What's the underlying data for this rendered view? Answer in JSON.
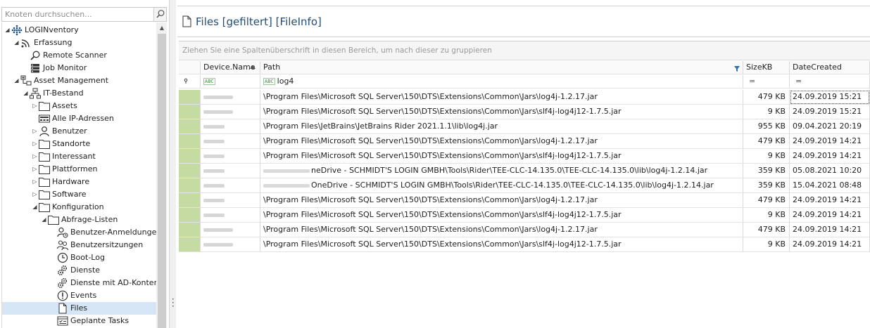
{
  "navigation": {
    "search_placeholder": "Knoten durchsuchen...",
    "tree": [
      {
        "label": "LOGINventory",
        "level": 0,
        "expander": "open",
        "icon": "loginventory-logo-icon"
      },
      {
        "label": "Erfassung",
        "level": 1,
        "expander": "open",
        "icon": "wifi-signal-icon"
      },
      {
        "label": "Remote Scanner",
        "level": 2,
        "expander": "none",
        "icon": "magnifier-icon"
      },
      {
        "label": "Job Monitor",
        "level": 2,
        "expander": "none",
        "icon": "server-icon"
      },
      {
        "label": "Asset Management",
        "level": 1,
        "expander": "open",
        "icon": "asset-network-icon"
      },
      {
        "label": "IT-Bestand",
        "level": 2,
        "expander": "open",
        "icon": "hierarchy-icon"
      },
      {
        "label": "Assets",
        "level": 3,
        "expander": "closed",
        "icon": "folder-icon"
      },
      {
        "label": "Alle IP-Adressen",
        "level": 3,
        "expander": "none",
        "icon": "ip-address-icon"
      },
      {
        "label": "Benutzer",
        "level": 3,
        "expander": "closed",
        "icon": "user-icon"
      },
      {
        "label": "Standorte",
        "level": 3,
        "expander": "closed",
        "icon": "folder-icon"
      },
      {
        "label": "Interessant",
        "level": 3,
        "expander": "closed",
        "icon": "folder-icon"
      },
      {
        "label": "Plattformen",
        "level": 3,
        "expander": "closed",
        "icon": "folder-icon"
      },
      {
        "label": "Hardware",
        "level": 3,
        "expander": "closed",
        "icon": "folder-icon"
      },
      {
        "label": "Software",
        "level": 3,
        "expander": "closed",
        "icon": "folder-icon"
      },
      {
        "label": "Konfiguration",
        "level": 3,
        "expander": "open",
        "icon": "folder-icon"
      },
      {
        "label": "Abfrage-Listen",
        "level": 4,
        "expander": "open",
        "icon": "folder-icon"
      },
      {
        "label": "Benutzer-Anmeldungen",
        "level": 5,
        "expander": "none",
        "icon": "user-login-icon"
      },
      {
        "label": "Benutzersitzungen",
        "level": 5,
        "expander": "none",
        "icon": "users-icon"
      },
      {
        "label": "Boot-Log",
        "level": 5,
        "expander": "none",
        "icon": "clock-icon"
      },
      {
        "label": "Dienste",
        "level": 5,
        "expander": "none",
        "icon": "gears-icon"
      },
      {
        "label": "Dienste mit AD-Konten",
        "level": 5,
        "expander": "none",
        "icon": "gears-icon"
      },
      {
        "label": "Events",
        "level": 5,
        "expander": "none",
        "icon": "exclamation-icon"
      },
      {
        "label": "Files",
        "level": 5,
        "expander": "none",
        "icon": "file-icon",
        "selected": true
      },
      {
        "label": "Geplante Tasks",
        "level": 5,
        "expander": "none",
        "icon": "tasks-icon"
      }
    ]
  },
  "page": {
    "title": "Files [gefiltert] [FileInfo]",
    "group_hint": "Ziehen Sie eine Spaltenüberschrift in diesen Bereich, um nach dieser zu gruppieren"
  },
  "grid": {
    "columns": [
      {
        "key": "device",
        "label": "Device.Name"
      },
      {
        "key": "path",
        "label": "Path"
      },
      {
        "key": "size",
        "label": "SizeKB"
      },
      {
        "key": "date",
        "label": "DateCreated"
      }
    ],
    "filter": {
      "device": "",
      "path": "log4",
      "size": "=",
      "date": "="
    },
    "rows": [
      {
        "path": "\\Program Files\\Microsoft SQL Server\\150\\DTS\\Extensions\\Common\\Jars\\log4j-1.2.17.jar",
        "size": "479 KB",
        "date": "24.09.2019 15:21"
      },
      {
        "path": "\\Program Files\\Microsoft SQL Server\\150\\DTS\\Extensions\\Common\\Jars\\slf4j-log4j12-1.7.5.jar",
        "size": "9 KB",
        "date": "24.09.2019 15:21"
      },
      {
        "path": "\\Program Files\\JetBrains\\JetBrains Rider 2021.1.1\\lib\\log4j.jar",
        "size": "955 KB",
        "date": "09.04.2021 20:19"
      },
      {
        "path": "\\Program Files\\Microsoft SQL Server\\150\\DTS\\Extensions\\Common\\Jars\\log4j-1.2.17.jar",
        "size": "479 KB",
        "date": "24.09.2019 14:21"
      },
      {
        "path": "\\Program Files\\Microsoft SQL Server\\150\\DTS\\Extensions\\Common\\Jars\\slf4j-log4j12-1.7.5.jar",
        "size": "9 KB",
        "date": "24.09.2019 14:21"
      },
      {
        "path": "neDrive - SCHMIDT'S LOGIN GMBH\\Tools\\Rider\\TEE-CLC-14.135.0\\TEE-CLC-14.135.0\\lib\\log4j-1.2.14.jar",
        "size": "359 KB",
        "date": "05.08.2021 10:20",
        "redacted_prefix": true
      },
      {
        "path": "OneDrive - SCHMIDT'S LOGIN GMBH\\Tools\\Rider\\TEE-CLC-14.135.0\\TEE-CLC-14.135.0\\lib\\log4j-1.2.14.jar",
        "size": "359 KB",
        "date": "15.04.2021 08:48",
        "redacted_prefix": true
      },
      {
        "path": "\\Program Files\\Microsoft SQL Server\\150\\DTS\\Extensions\\Common\\Jars\\log4j-1.2.17.jar",
        "size": "479 KB",
        "date": "24.09.2019 14:21"
      },
      {
        "path": "\\Program Files\\Microsoft SQL Server\\150\\DTS\\Extensions\\Common\\Jars\\slf4j-log4j12-1.7.5.jar",
        "size": "9 KB",
        "date": "24.09.2019 14:21"
      },
      {
        "path": "\\Program Files\\Microsoft SQL Server\\150\\DTS\\Extensions\\Common\\Jars\\log4j-1.2.17.jar",
        "size": "479 KB",
        "date": "24.09.2019 14:21"
      },
      {
        "path": "\\Program Files\\Microsoft SQL Server\\150\\DTS\\Extensions\\Common\\Jars\\slf4j-log4j12-1.7.5.jar",
        "size": "9 KB",
        "date": "24.09.2019 14:21"
      }
    ]
  },
  "colors": {
    "title": "#1f4e79",
    "row_indicator": "#c5dba1",
    "selected_node": "#d7e6f7"
  }
}
